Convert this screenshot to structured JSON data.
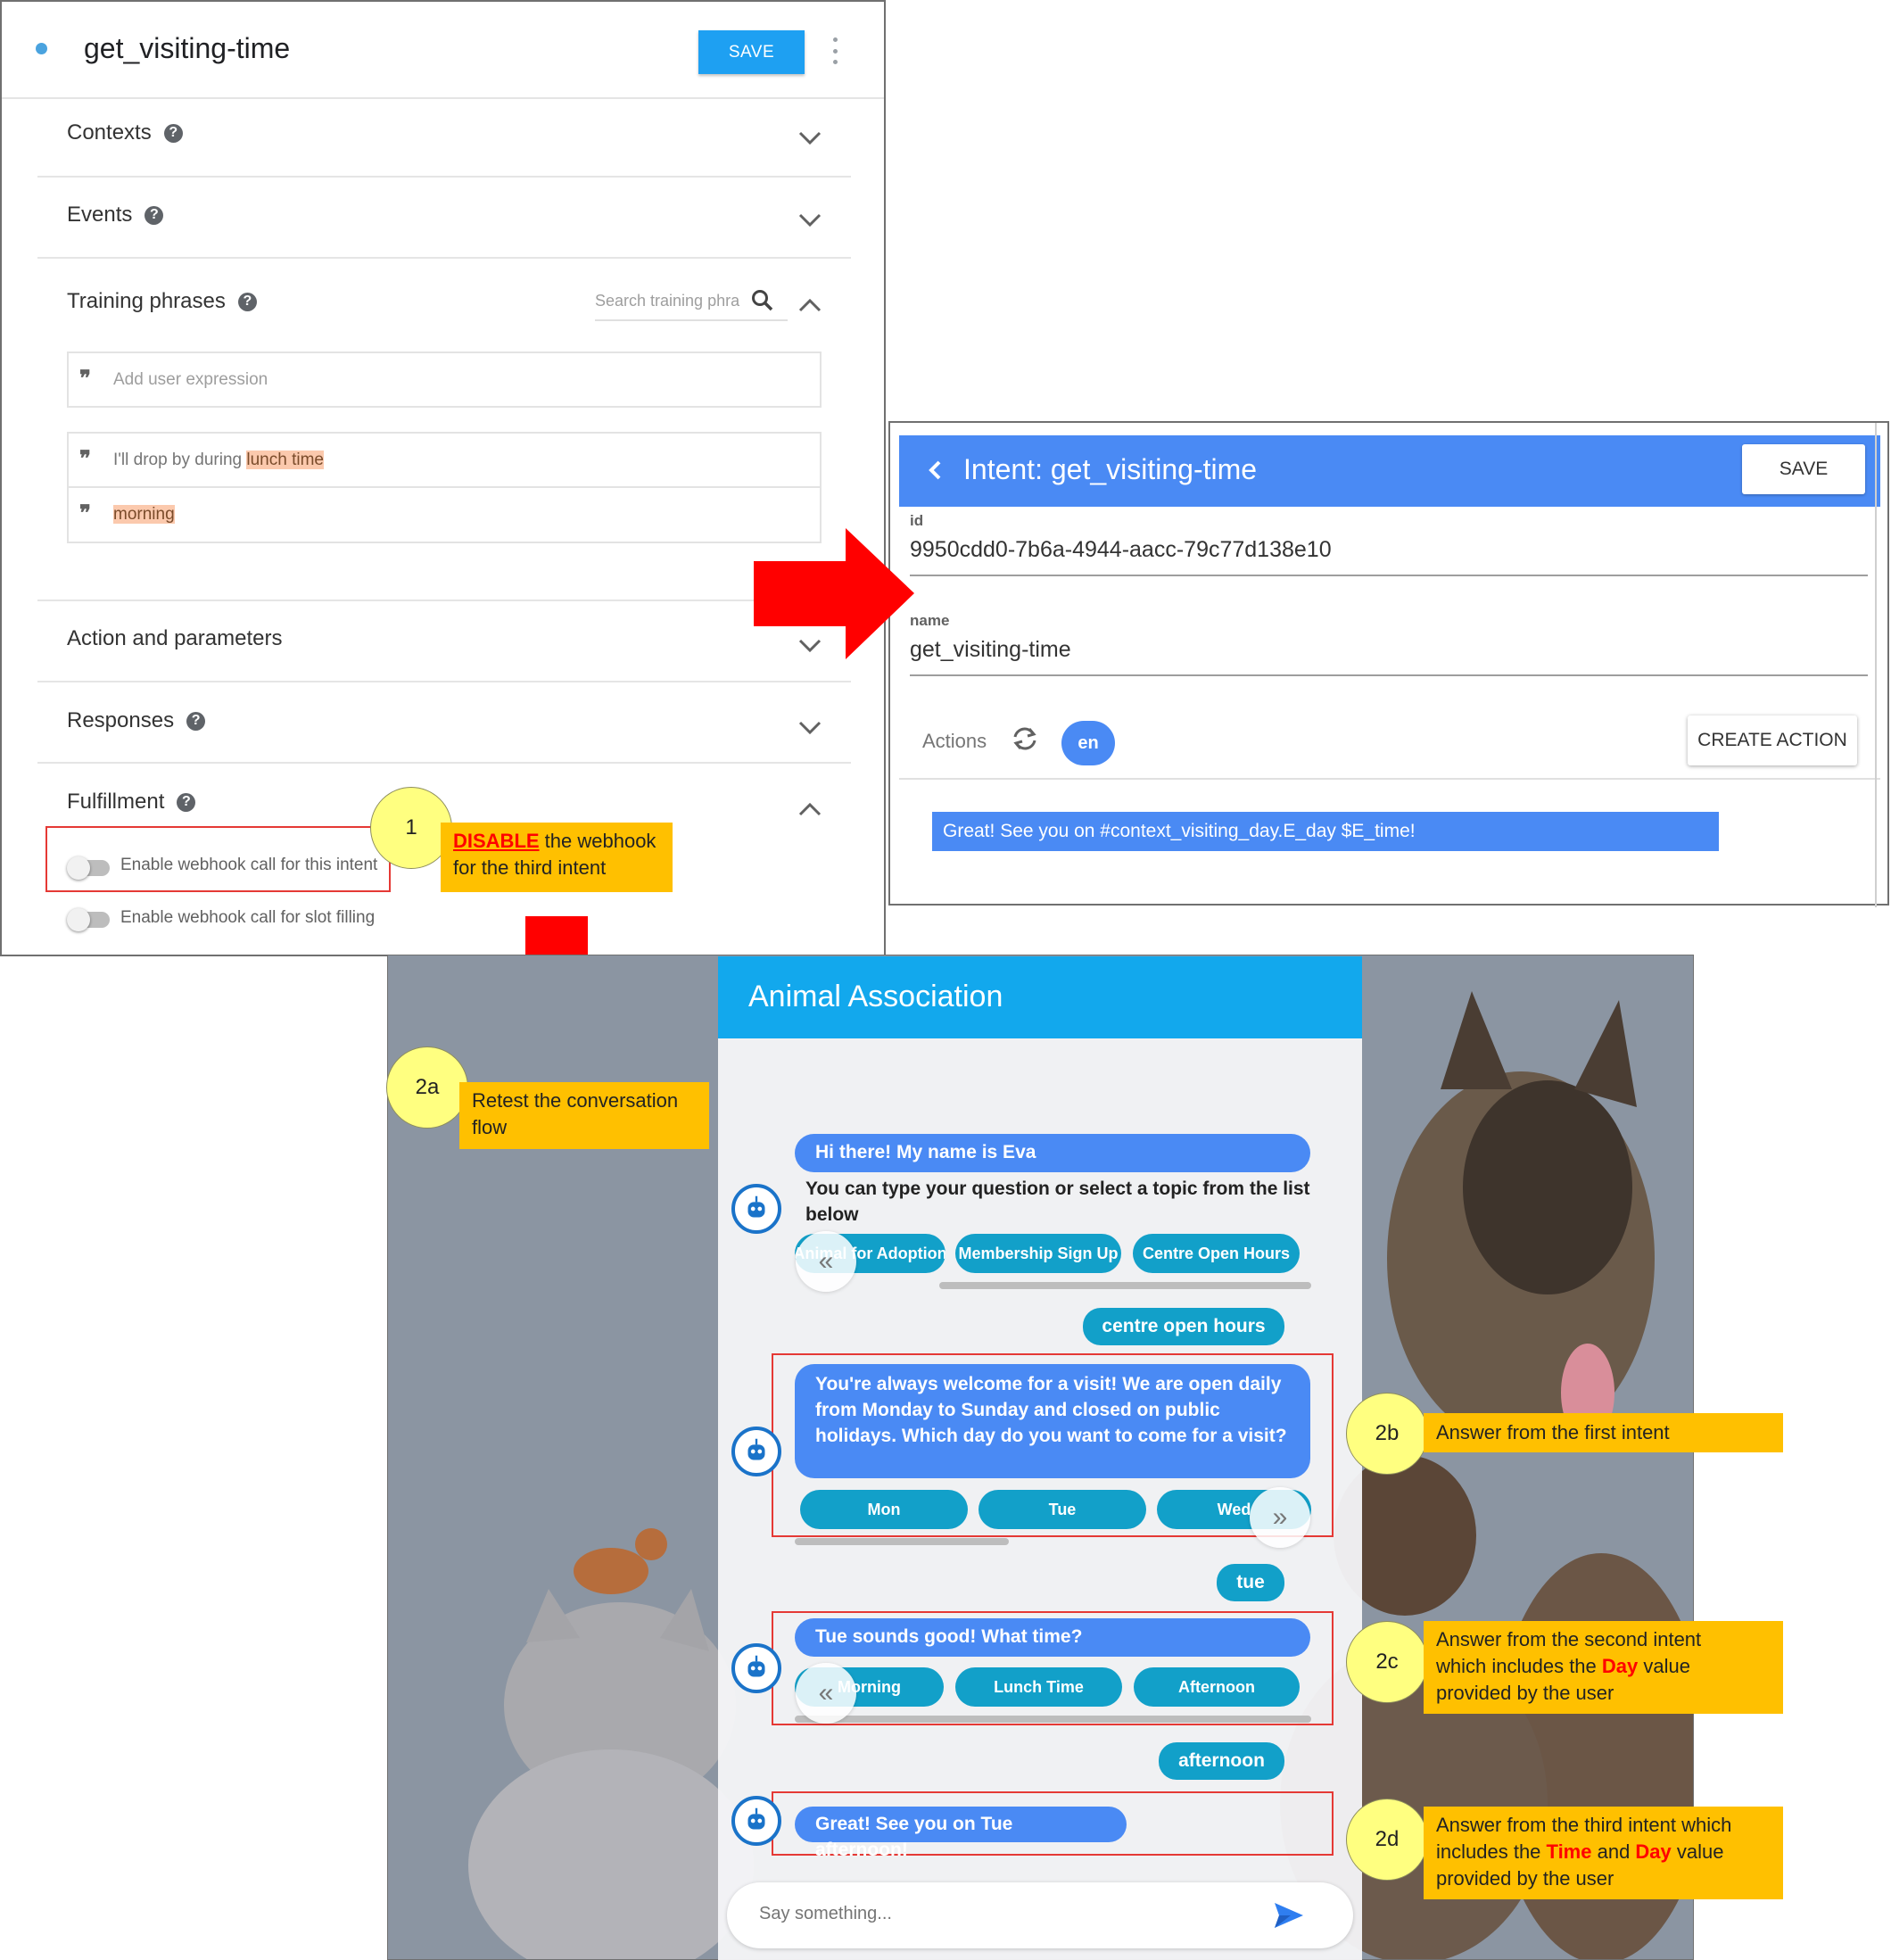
{
  "editor": {
    "intent_title": "get_visiting-time",
    "save_label": "SAVE",
    "sections": {
      "contexts": "Contexts",
      "events": "Events",
      "training": "Training phrases",
      "action": "Action and parameters",
      "responses": "Responses",
      "fulfillment": "Fulfillment"
    },
    "search_placeholder": "Search training phra",
    "add_expression_placeholder": "Add user expression",
    "phrases": [
      {
        "prefix": "I'll drop by during ",
        "entity": "lunch time"
      },
      {
        "prefix": "",
        "entity": "morning"
      }
    ],
    "toggles": {
      "webhook_intent": "Enable webhook call for this intent",
      "webhook_slot": "Enable webhook call for slot filling"
    },
    "help_icon": "help-circle-icon",
    "quote_icon": "quote-icon"
  },
  "intent_panel": {
    "header_title": "Intent: get_visiting-time",
    "save_label": "SAVE",
    "id_label": "id",
    "id_value": "9950cdd0-7b6a-4944-aacc-79c77d138e10",
    "name_label": "name",
    "name_value": "get_visiting-time",
    "actions_label": "Actions",
    "lang_chip": "en",
    "create_action_label": "CREATE ACTION",
    "response_text": "Great! See you on #context_visiting_day.E_day $E_time!"
  },
  "chat": {
    "header_title": "Animal Association",
    "greeting": "Hi there! My name is Eva",
    "instruction": "You can type your question or select a topic from the list below",
    "topic_chips": [
      "Animal for Adoption",
      "Membership Sign Up",
      "Centre Open Hours"
    ],
    "user_msg_1": "centre open hours",
    "bot_answer_1": "You're always welcome for a visit! We are open daily from Monday to Sunday and closed on public holidays. Which day do you want to come for a visit?",
    "day_chips": [
      "Mon",
      "Tue",
      "Wed"
    ],
    "user_msg_2": "tue",
    "bot_answer_2": "Tue sounds good! What time?",
    "time_chips": [
      "Morning",
      "Lunch Time",
      "Afternoon"
    ],
    "user_msg_3": "afternoon",
    "bot_answer_3": "Great! See you on Tue afternoon!",
    "input_placeholder": "Say something...",
    "prev_glyph": "«",
    "next_glyph": "»"
  },
  "callouts": {
    "c1": {
      "num": "1",
      "highlight": "DISABLE",
      "line1_rest": " the webhook",
      "line2": "for the third intent"
    },
    "c2a": {
      "num": "2a",
      "text": "Retest the conversation flow"
    },
    "c2b": {
      "num": "2b",
      "text": "Answer from the first intent"
    },
    "c2c": {
      "num": "2c",
      "line1": "Answer from the second intent",
      "line2_pre": "which includes the ",
      "line2_hl": "Day",
      "line2_post": " value",
      "line3": "provided by the user"
    },
    "c2d": {
      "num": "2d",
      "line1": "Answer from the third intent which",
      "line2_pre": "includes the ",
      "line2_hl1": "Time",
      "line2_mid": " and ",
      "line2_hl2": "Day",
      "line2_post": " value",
      "line3": "provided by the user"
    }
  },
  "colors": {
    "accent_blue": "#4a8af4",
    "chat_header": "#12a8ed",
    "chip_teal": "#12a0c9",
    "callout_yellow": "#ffc000",
    "circle_yellow": "#ffff80",
    "arrow_red": "#ff0000"
  }
}
